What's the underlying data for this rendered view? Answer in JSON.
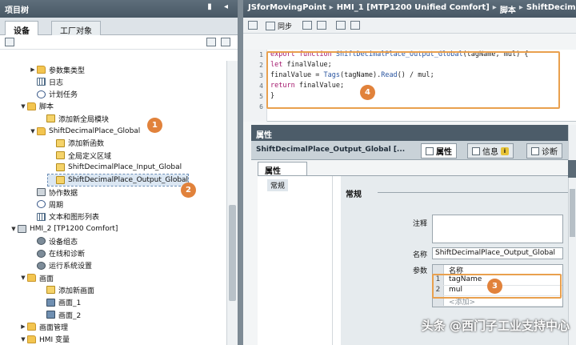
{
  "project_tree": {
    "title": "项目树",
    "window_controls": "▮ ◂",
    "tabs": [
      "设备",
      "工厂对象"
    ],
    "items": [
      {
        "label": "参数集类型",
        "icon": "folder-icon",
        "expanded": false
      },
      {
        "label": "日志",
        "icon": "grid-icon"
      },
      {
        "label": "计划任务",
        "icon": "clock-icon"
      },
      {
        "label": "脚本",
        "icon": "folder-icon",
        "expanded": true
      },
      {
        "label": "添加新全局模块",
        "icon": "js-icon"
      },
      {
        "label": "ShiftDecimalPlace_Global",
        "icon": "folder-icon",
        "expanded": true
      },
      {
        "label": "添加新函数",
        "icon": "js-icon"
      },
      {
        "label": "全局定义区域",
        "icon": "js-icon"
      },
      {
        "label": "ShiftDecimalPlace_Input_Global",
        "icon": "js-icon"
      },
      {
        "label": "ShiftDecimalPlace_Output_Global",
        "icon": "js-icon",
        "selected": true
      },
      {
        "label": "协作数据",
        "icon": "device-icon"
      },
      {
        "label": "周期",
        "icon": "clock-icon"
      },
      {
        "label": "文本和图形列表",
        "icon": "grid-icon"
      },
      {
        "label": "HMI_2 [TP1200 Comfort]",
        "icon": "device-icon",
        "expanded": true
      },
      {
        "label": "设备组态",
        "icon": "gear-icon"
      },
      {
        "label": "在线和诊断",
        "icon": "gear-icon"
      },
      {
        "label": "运行系统设置",
        "icon": "gear-icon"
      },
      {
        "label": "画面",
        "icon": "folder-icon",
        "expanded": true
      },
      {
        "label": "添加新画面",
        "icon": "js-icon"
      },
      {
        "label": "画面_1",
        "icon": "screen-icon"
      },
      {
        "label": "画面_2",
        "icon": "screen-icon"
      },
      {
        "label": "画面管理",
        "icon": "folder-icon",
        "expanded": false
      },
      {
        "label": "HMI 变量",
        "icon": "folder-icon",
        "expanded": true
      }
    ]
  },
  "breadcrumb": {
    "items": [
      "JSforMovingPoint",
      "HMI_1 [MTP1200 Unified Comfort]",
      "脚本",
      "ShiftDecimal"
    ],
    "separator": "▸"
  },
  "editor": {
    "sync_label": "同步",
    "lines": [
      {
        "num": "1",
        "code": "export function ShiftDecimalPlace_Output_Global(tagName, mul) {"
      },
      {
        "num": "2",
        "code": "let finalValue;"
      },
      {
        "num": "3",
        "code": "finalValue = Tags(tagName).Read() / mul;"
      },
      {
        "num": "4",
        "code": "return finalValue;"
      },
      {
        "num": "5",
        "code": "}"
      },
      {
        "num": "6",
        "code": ""
      }
    ]
  },
  "properties": {
    "header": "属性",
    "object_name": "ShiftDecimalPlace_Output_Global [...",
    "tabs": [
      "属性",
      "信息",
      "诊断"
    ],
    "info_badge": "i",
    "subtab": "属性",
    "nav_item": "常规",
    "section": "常规",
    "comment_label": "注释",
    "name_label": "名称",
    "name_value": "ShiftDecimalPlace_Output_Global",
    "params_label": "参数",
    "table": {
      "header": "名称",
      "rows": [
        {
          "num": "1",
          "name": "tagName"
        },
        {
          "num": "2",
          "name": "mul"
        }
      ],
      "add": "<添加>"
    }
  },
  "badges": [
    "1",
    "2",
    "3",
    "4"
  ],
  "accent_color": "#e1823b",
  "watermark": "头条 @西门子工业支持中心"
}
